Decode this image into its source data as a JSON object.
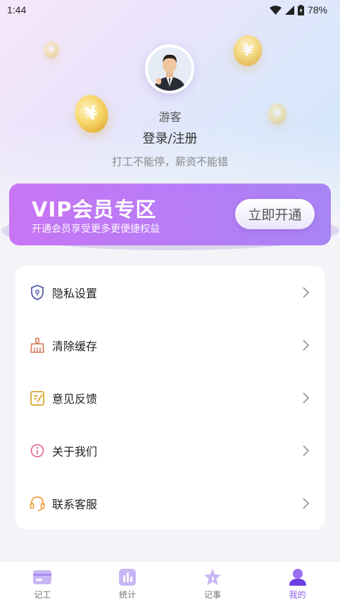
{
  "status_bar": {
    "time": "1:44",
    "battery": "78%"
  },
  "profile": {
    "name": "游客",
    "login_label": "登录/注册",
    "slogan": "打工不能停，薪资不能错"
  },
  "vip": {
    "title": "VIP会员专区",
    "subtitle": "开通会员享受更多更便捷权益",
    "button_label": "立即开通"
  },
  "menu": {
    "items": [
      {
        "label": "隐私设置",
        "icon": "shield-lock-icon"
      },
      {
        "label": "清除缓存",
        "icon": "broom-icon"
      },
      {
        "label": "意见反馈",
        "icon": "feedback-note-icon"
      },
      {
        "label": "关于我们",
        "icon": "info-icon"
      },
      {
        "label": "联系客服",
        "icon": "headset-icon"
      }
    ]
  },
  "tabbar": {
    "tabs": [
      {
        "label": "记工",
        "icon": "card-icon"
      },
      {
        "label": "统计",
        "icon": "chart-icon"
      },
      {
        "label": "记事",
        "icon": "star-icon"
      },
      {
        "label": "我的",
        "icon": "user-icon"
      }
    ],
    "active": "我的"
  },
  "colors": {
    "accent": "#8f5cf0",
    "vip_gradient_start": "#c775f4",
    "vip_gradient_end": "#a884f4"
  }
}
